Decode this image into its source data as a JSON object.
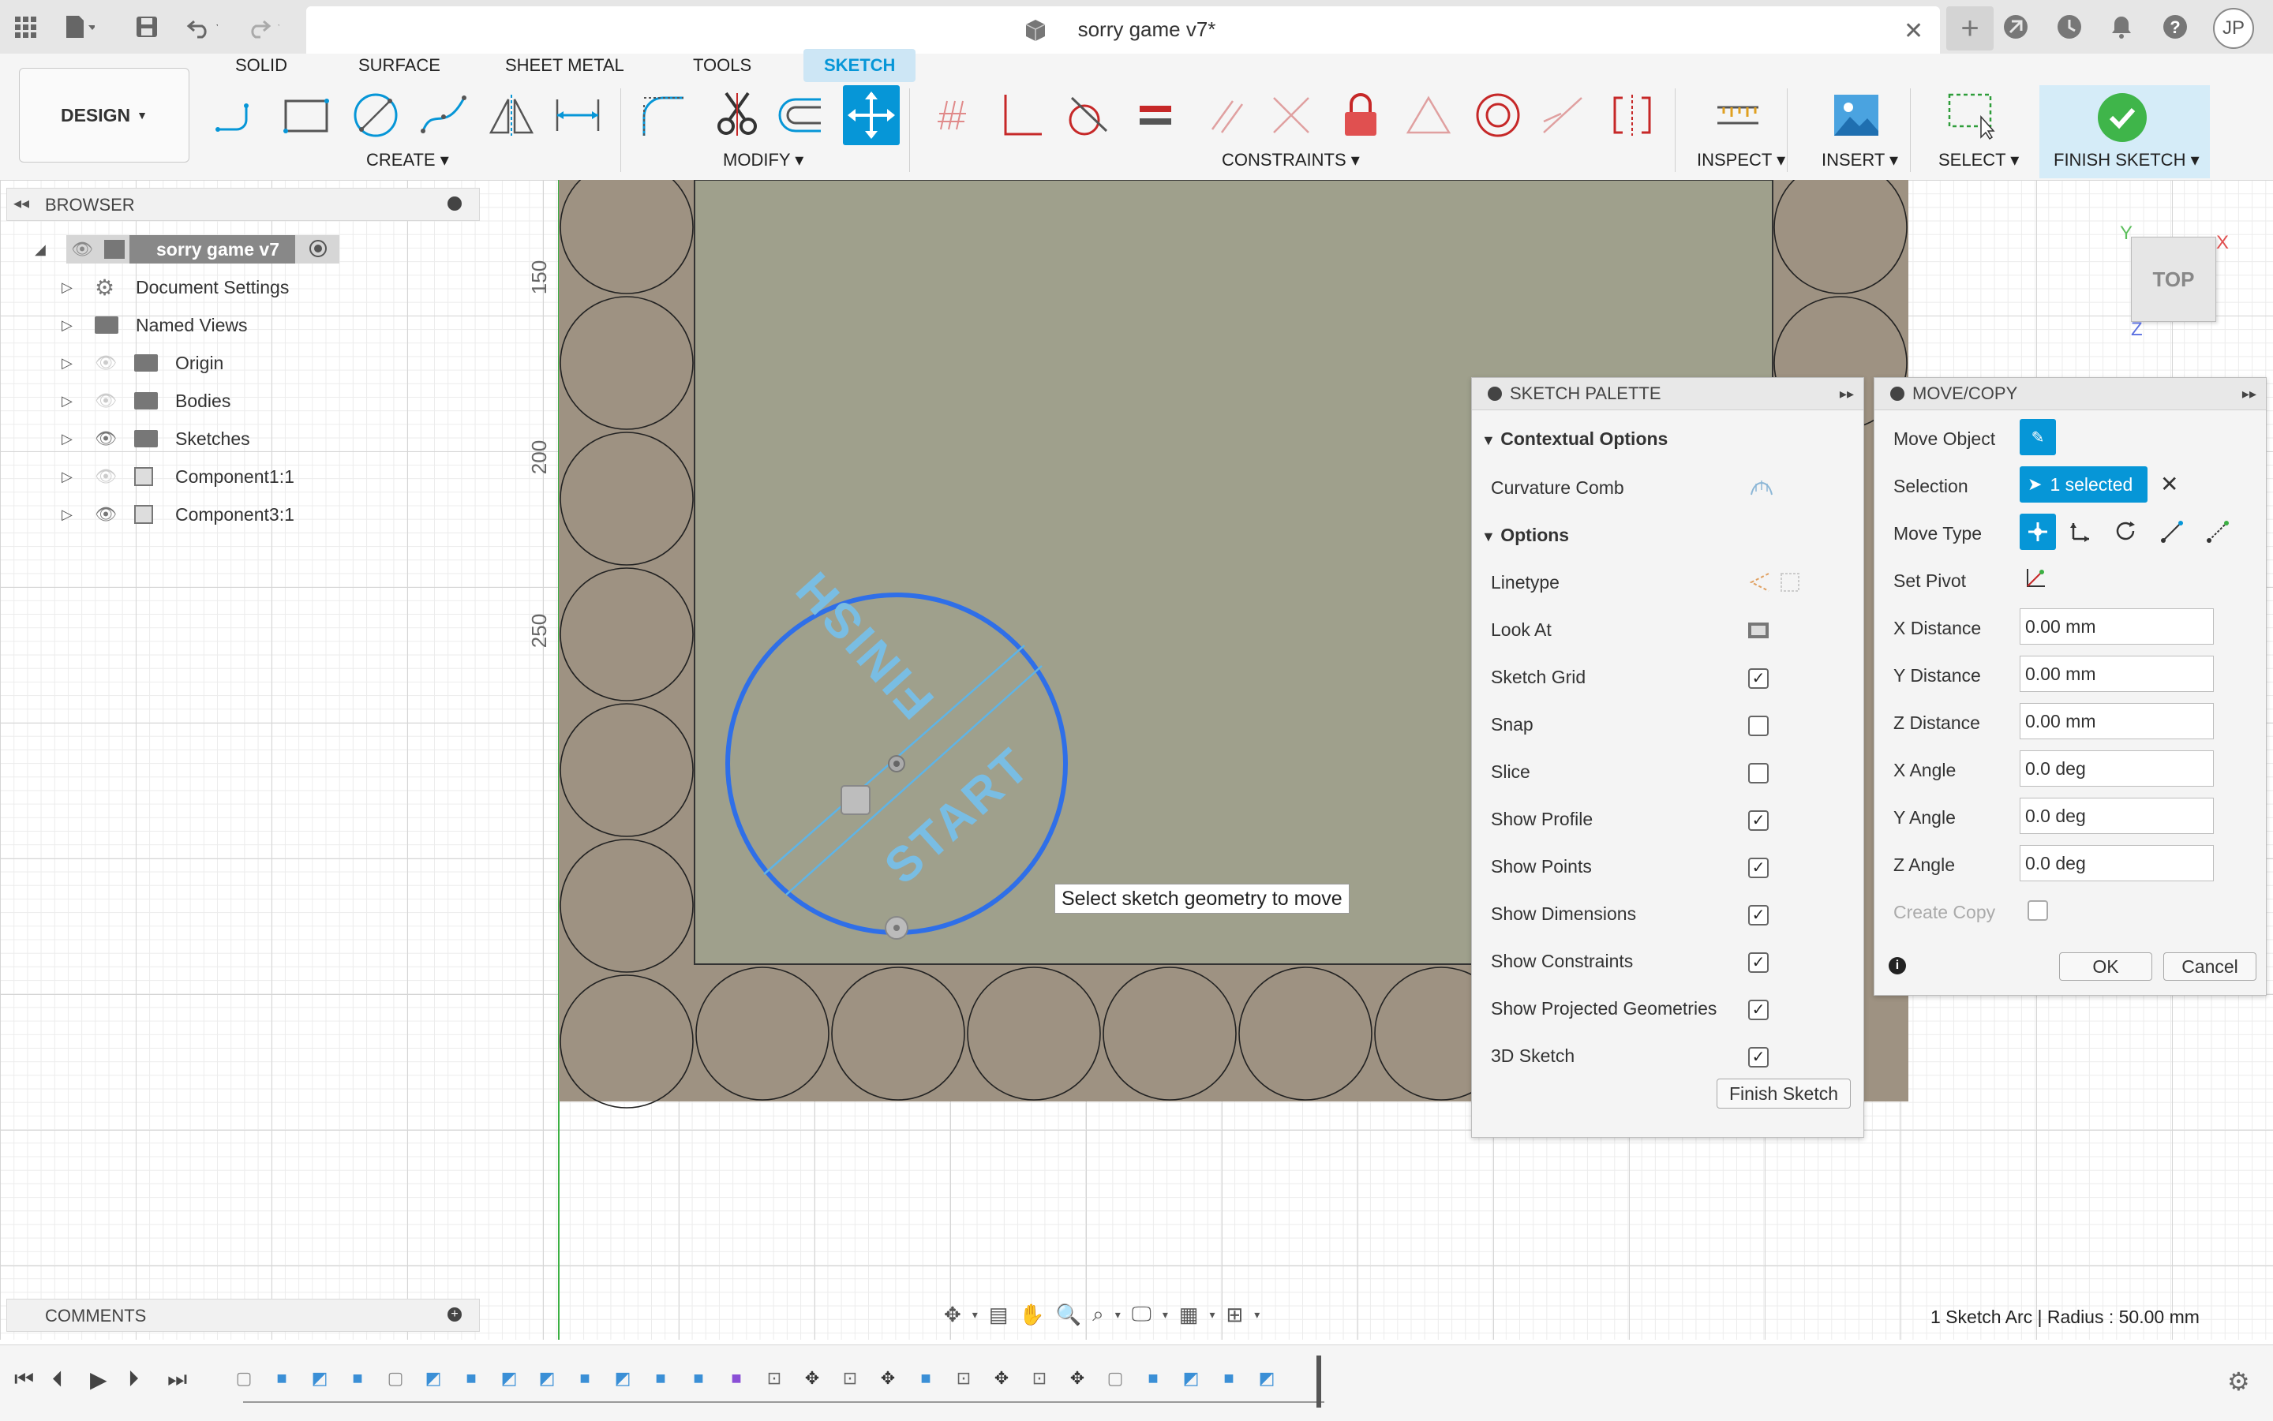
{
  "title_bar": {
    "doc_title": "sorry game v7*",
    "user_initials": "JP"
  },
  "ribbon": {
    "tabs": [
      "SOLID",
      "SURFACE",
      "SHEET METAL",
      "TOOLS",
      "SKETCH"
    ],
    "active_tab": "SKETCH",
    "workspace_button": "DESIGN",
    "groups": {
      "create": "CREATE",
      "modify": "MODIFY",
      "constraints": "CONSTRAINTS",
      "inspect": "INSPECT",
      "insert": "INSERT",
      "select": "SELECT",
      "finish": "FINISH SKETCH"
    },
    "accent_color": "#0696d7"
  },
  "browser": {
    "header": "BROWSER",
    "items": [
      {
        "label": "sorry game v7"
      },
      {
        "label": "Document Settings"
      },
      {
        "label": "Named Views"
      },
      {
        "label": "Origin"
      },
      {
        "label": "Bodies"
      },
      {
        "label": "Sketches"
      },
      {
        "label": "Component1:1"
      },
      {
        "label": "Component3:1"
      }
    ]
  },
  "comments": {
    "header": "COMMENTS"
  },
  "canvas": {
    "ruler_labels": [
      "150",
      "200",
      "250"
    ],
    "sketch_text_1": "FINISH",
    "sketch_text_2": "START",
    "tooltip": "Select sketch geometry to move",
    "view_cube": "TOP",
    "axis_x": "X",
    "axis_y": "Y",
    "axis_z": "Z"
  },
  "sketch_palette": {
    "title": "SKETCH PALETTE",
    "sections": {
      "contextual": "Contextual Options",
      "options": "Options"
    },
    "contextual_items": [
      {
        "label": "Curvature Comb"
      }
    ],
    "option_items": [
      {
        "label": "Linetype"
      },
      {
        "label": "Look At"
      },
      {
        "label": "Sketch Grid",
        "checked": true
      },
      {
        "label": "Snap",
        "checked": false
      },
      {
        "label": "Slice",
        "checked": false
      },
      {
        "label": "Show Profile",
        "checked": true
      },
      {
        "label": "Show Points",
        "checked": true
      },
      {
        "label": "Show Dimensions",
        "checked": true
      },
      {
        "label": "Show Constraints",
        "checked": true
      },
      {
        "label": "Show Projected Geometries",
        "checked": true
      },
      {
        "label": "3D Sketch",
        "checked": true
      }
    ],
    "finish_button": "Finish Sketch"
  },
  "move_copy": {
    "title": "MOVE/COPY",
    "move_object_label": "Move Object",
    "selection_label": "Selection",
    "selection_value": "1 selected",
    "move_type_label": "Move Type",
    "set_pivot_label": "Set Pivot",
    "fields": [
      {
        "label": "X Distance",
        "value": "0.00 mm"
      },
      {
        "label": "Y Distance",
        "value": "0.00 mm"
      },
      {
        "label": "Z Distance",
        "value": "0.00 mm"
      },
      {
        "label": "X Angle",
        "value": "0.0 deg"
      },
      {
        "label": "Y Angle",
        "value": "0.0 deg"
      },
      {
        "label": "Z Angle",
        "value": "0.0 deg"
      }
    ],
    "create_copy_label": "Create Copy",
    "ok": "OK",
    "cancel": "Cancel"
  },
  "status_bar": {
    "measure": "1 Sketch Arc | Radius : 50.00 mm"
  }
}
